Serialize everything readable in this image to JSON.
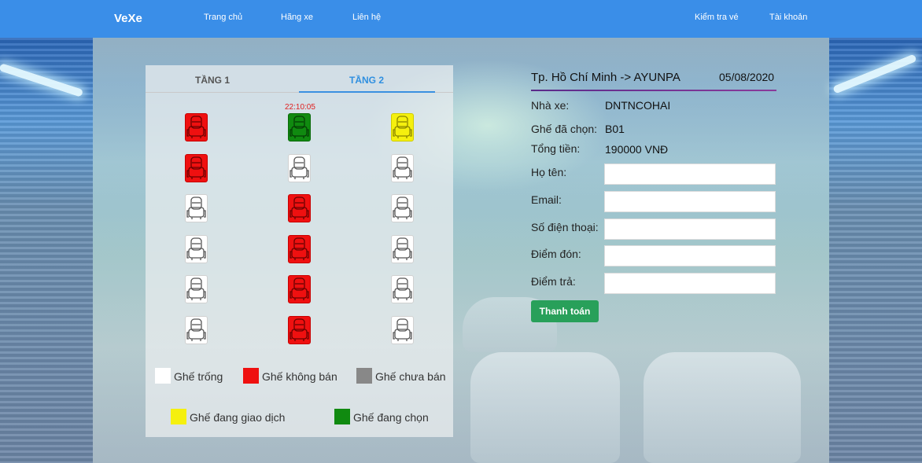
{
  "navbar": {
    "brand": "VeXe",
    "links": [
      "Trang chủ",
      "Hãng xe",
      "Liên hệ"
    ],
    "right_links": [
      "Kiểm tra vé",
      "Tài khoản"
    ]
  },
  "seat_map": {
    "tabs": [
      "TẦNG 1",
      "TẦNG 2"
    ],
    "active_tab": "TẦNG 2",
    "timer": "22:10:05",
    "rows": [
      [
        "red",
        "green",
        "yellow"
      ],
      [
        "red",
        "white",
        "white"
      ],
      [
        "white",
        "red",
        "white"
      ],
      [
        "white",
        "red",
        "white"
      ],
      [
        "white",
        "red",
        "white"
      ],
      [
        "white",
        "red",
        "white"
      ]
    ],
    "status_colors": {
      "white": "#ffffff",
      "red": "#ef1010",
      "gray": "#888888",
      "yellow": "#f5f00e",
      "green": "#108a10"
    }
  },
  "legend": {
    "empty": "Ghế trống",
    "not_for_sale": "Ghế không bán",
    "unsold": "Ghế chưa bán",
    "in_transaction": "Ghế đang giao dịch",
    "selected": "Ghế đang chọn"
  },
  "trip": {
    "route": "Tp. Hồ Chí Minh -> AYUNPA",
    "date": "05/08/2020",
    "operator_label": "Nhà xe:",
    "operator": "DNTNCOHAI",
    "seat_label": "Ghế đã chọn:",
    "seat": "B01",
    "total_label": "Tổng tiền:",
    "total": "190000 VNĐ"
  },
  "form": {
    "name_label": "Họ tên:",
    "email_label": "Email:",
    "phone_label": "Số điện thoại:",
    "pickup_label": "Điểm đón:",
    "dropoff_label": "Điểm trả:",
    "name_value": "",
    "email_value": "",
    "phone_value": "",
    "pickup_value": "",
    "dropoff_value": "",
    "submit_label": "Thanh toán"
  }
}
